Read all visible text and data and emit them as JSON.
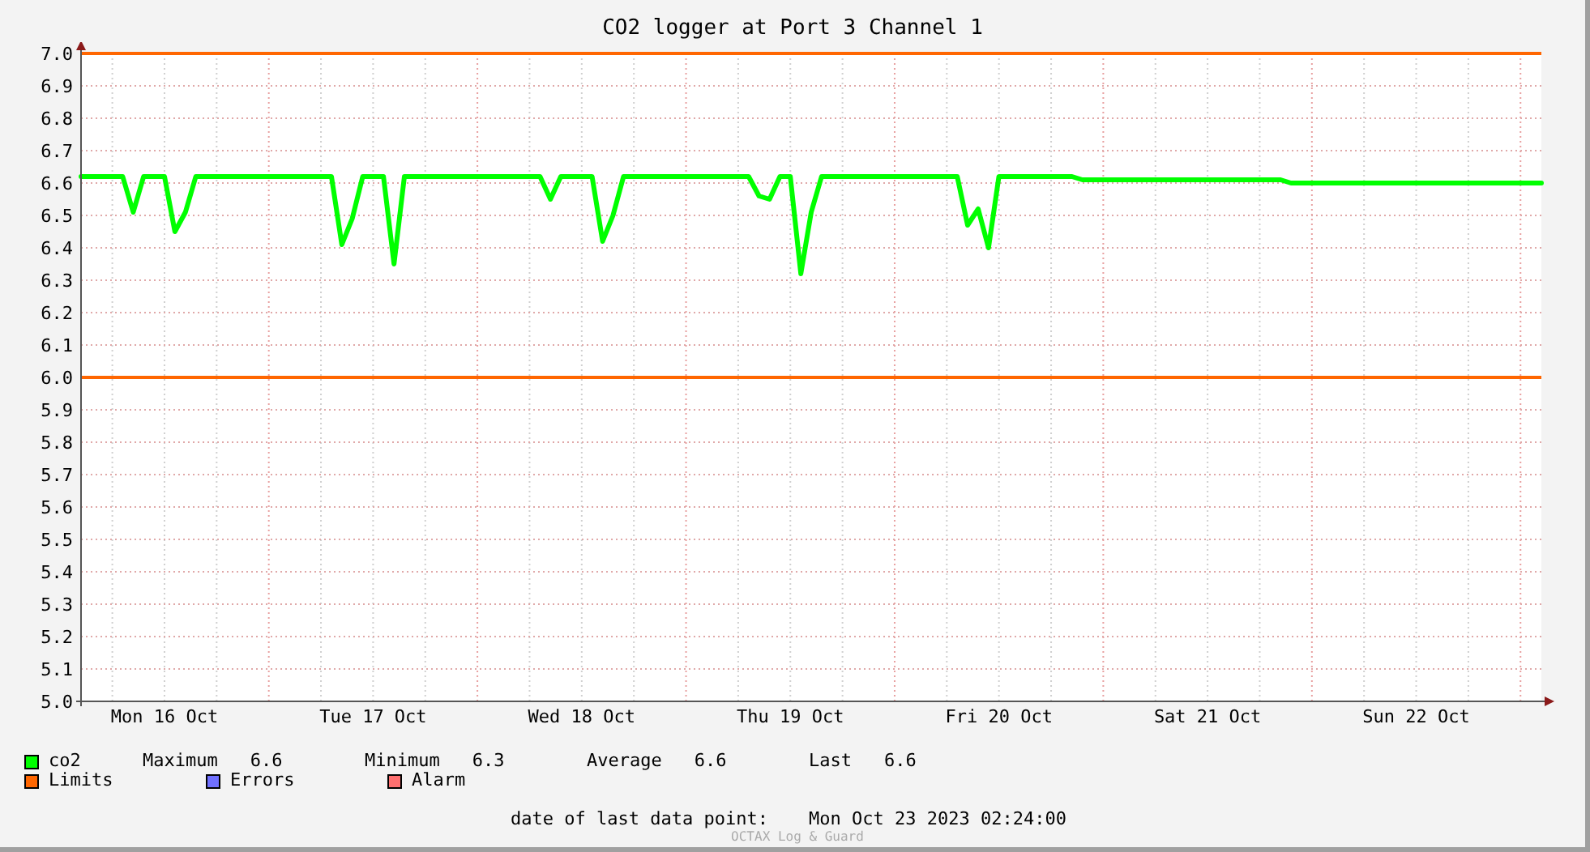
{
  "title": "CO2 logger at Port 3 Channel 1",
  "chart_data": {
    "type": "line",
    "ylim": [
      5,
      7
    ],
    "categories": [
      null,
      null,
      null,
      null,
      null,
      null,
      null,
      null,
      "Mon 16 Oct",
      null,
      null,
      null,
      null,
      null,
      null,
      null,
      null,
      null,
      null,
      null,
      null,
      null,
      null,
      null,
      null,
      null,
      null,
      null,
      "Tue 17 Oct",
      null,
      null,
      null,
      null,
      null,
      null,
      null,
      null,
      null,
      null,
      null,
      null,
      null,
      null,
      null,
      null,
      null,
      null,
      null,
      "Wed 18 Oct",
      null,
      null,
      null,
      null,
      null,
      null,
      null,
      null,
      null,
      null,
      null,
      null,
      null,
      null,
      null,
      null,
      null,
      null,
      null,
      "Thu 19 Oct",
      null,
      null,
      null,
      null,
      null,
      null,
      null,
      null,
      null,
      null,
      null,
      null,
      null,
      null,
      null,
      null,
      null,
      null,
      null,
      "Fri 20 Oct",
      null,
      null,
      null,
      null,
      null,
      null,
      null,
      null,
      null,
      null,
      null,
      null,
      null,
      null,
      null,
      null,
      null,
      null,
      null,
      "Sat 21 Oct",
      null,
      null,
      null,
      null,
      null,
      null,
      null,
      null,
      null,
      null,
      null,
      null,
      null,
      null,
      null,
      null,
      null,
      null,
      null,
      "Sun 22 Oct",
      null,
      null,
      null,
      null,
      null,
      null,
      null,
      null,
      null,
      null,
      null,
      null
    ],
    "yticks": [
      {
        "value": 5,
        "label": "5.0"
      },
      {
        "value": 5.1,
        "label": "5.1"
      },
      {
        "value": 5.2,
        "label": "5.2"
      },
      {
        "value": 5.3,
        "label": "5.3"
      },
      {
        "value": 5.4,
        "label": "5.4"
      },
      {
        "value": 5.5,
        "label": "5.5"
      },
      {
        "value": 5.6,
        "label": "5.6"
      },
      {
        "value": 5.7,
        "label": "5.7"
      },
      {
        "value": 5.8,
        "label": "5.8"
      },
      {
        "value": 5.9,
        "label": "5.9"
      },
      {
        "value": 6,
        "label": "6.0"
      },
      {
        "value": 6.1,
        "label": "6.1"
      },
      {
        "value": 6.2,
        "label": "6.2"
      },
      {
        "value": 6.3,
        "label": "6.3"
      },
      {
        "value": 6.4,
        "label": "6.4"
      },
      {
        "value": 6.5,
        "label": "6.5"
      },
      {
        "value": 6.6,
        "label": "6.6"
      },
      {
        "value": 6.7,
        "label": "6.7"
      },
      {
        "value": 6.8,
        "label": "6.8"
      },
      {
        "value": 6.9,
        "label": "6.9"
      },
      {
        "value": 7,
        "label": "7.0"
      }
    ],
    "series": [
      {
        "name": "co2",
        "color": "#00ff00",
        "values": [
          6.62,
          6.62,
          6.62,
          6.62,
          6.62,
          6.51,
          6.62,
          6.62,
          6.62,
          6.45,
          6.51,
          6.62,
          6.62,
          6.62,
          6.62,
          6.62,
          6.62,
          6.62,
          6.62,
          6.62,
          6.62,
          6.62,
          6.62,
          6.62,
          6.62,
          6.41,
          6.49,
          6.62,
          6.62,
          6.62,
          6.35,
          6.62,
          6.62,
          6.62,
          6.62,
          6.62,
          6.62,
          6.62,
          6.62,
          6.62,
          6.62,
          6.62,
          6.62,
          6.62,
          6.62,
          6.55,
          6.62,
          6.62,
          6.62,
          6.62,
          6.42,
          6.5,
          6.62,
          6.62,
          6.62,
          6.62,
          6.62,
          6.62,
          6.62,
          6.62,
          6.62,
          6.62,
          6.62,
          6.62,
          6.62,
          6.56,
          6.55,
          6.62,
          6.62,
          6.32,
          6.51,
          6.62,
          6.62,
          6.62,
          6.62,
          6.62,
          6.62,
          6.62,
          6.62,
          6.62,
          6.62,
          6.62,
          6.62,
          6.62,
          6.62,
          6.47,
          6.52,
          6.4,
          6.62,
          6.62,
          6.62,
          6.62,
          6.62,
          6.62,
          6.62,
          6.62,
          6.61,
          6.61,
          6.61,
          6.61,
          6.61,
          6.61,
          6.61,
          6.61,
          6.61,
          6.61,
          6.61,
          6.61,
          6.61,
          6.61,
          6.61,
          6.61,
          6.61,
          6.61,
          6.61,
          6.61,
          6.6,
          6.6,
          6.6,
          6.6,
          6.6,
          6.6,
          6.6,
          6.6,
          6.6,
          6.6,
          6.6,
          6.6,
          6.6,
          6.6,
          6.6,
          6.6,
          6.6,
          6.6,
          6.6,
          6.6,
          6.6,
          6.6,
          6.6,
          6.6,
          6.6
        ]
      },
      {
        "name": "Limits",
        "color": "#ff6600",
        "values": [
          7,
          7,
          7,
          7,
          7,
          7,
          7,
          7,
          7,
          7,
          7,
          7,
          7,
          7,
          7,
          7,
          7,
          7,
          7,
          7,
          7,
          7,
          7,
          7,
          7,
          7,
          7,
          7,
          7,
          7,
          7,
          7,
          7,
          7,
          7,
          7,
          7,
          7,
          7,
          7,
          7,
          7,
          7,
          7,
          7,
          7,
          7,
          7,
          7,
          7,
          7,
          7,
          7,
          7,
          7,
          7,
          7,
          7,
          7,
          7,
          7,
          7,
          7,
          7,
          7,
          7,
          7,
          7,
          7,
          7,
          7,
          7,
          7,
          7,
          7,
          7,
          7,
          7,
          7,
          7,
          7,
          7,
          7,
          7,
          7,
          7,
          7,
          7,
          7,
          7,
          7,
          7,
          7,
          7,
          7,
          7,
          7,
          7,
          7,
          7,
          7,
          7,
          7,
          7,
          7,
          7,
          7,
          7,
          7,
          7,
          7,
          7,
          7,
          7,
          7,
          7,
          7,
          7,
          7,
          7,
          7,
          7,
          7,
          7,
          7,
          7,
          7,
          7,
          7,
          7,
          7,
          7,
          7,
          7,
          7,
          7,
          7,
          7,
          7,
          7,
          7
        ]
      },
      {
        "color": "#ff6600",
        "values": [
          6,
          6,
          6,
          6,
          6,
          6,
          6,
          6,
          6,
          6,
          6,
          6,
          6,
          6,
          6,
          6,
          6,
          6,
          6,
          6,
          6,
          6,
          6,
          6,
          6,
          6,
          6,
          6,
          6,
          6,
          6,
          6,
          6,
          6,
          6,
          6,
          6,
          6,
          6,
          6,
          6,
          6,
          6,
          6,
          6,
          6,
          6,
          6,
          6,
          6,
          6,
          6,
          6,
          6,
          6,
          6,
          6,
          6,
          6,
          6,
          6,
          6,
          6,
          6,
          6,
          6,
          6,
          6,
          6,
          6,
          6,
          6,
          6,
          6,
          6,
          6,
          6,
          6,
          6,
          6,
          6,
          6,
          6,
          6,
          6,
          6,
          6,
          6,
          6,
          6,
          6,
          6,
          6,
          6,
          6,
          6,
          6,
          6,
          6,
          6,
          6,
          6,
          6,
          6,
          6,
          6,
          6,
          6,
          6,
          6,
          6,
          6,
          6,
          6,
          6,
          6,
          6,
          6,
          6,
          6,
          6,
          6,
          6,
          6,
          6,
          6,
          6,
          6,
          6,
          6,
          6,
          6,
          6,
          6,
          6,
          6,
          6,
          6,
          6,
          6,
          6
        ]
      }
    ],
    "grid": true,
    "stacked": false
  },
  "legend": [
    {
      "stats": [
        {
          "label": "Maximum",
          "value": "6.6"
        },
        {
          "label": "Minimum",
          "value": "6.3"
        },
        {
          "label": "Average",
          "value": "6.6"
        },
        {
          "label": "Last",
          "value": "6.6"
        }
      ]
    },
    {
      "kind": "series"
    },
    {
      "label": "Errors",
      "color": "#7070ff"
    },
    {
      "label": "Alarm",
      "color": "#ff7070"
    }
  ],
  "last_data_point": {
    "label": "date of last data point:",
    "value": "Mon Oct 23 2023 02:24:00"
  },
  "credit": "OCTAX Log & Guard"
}
